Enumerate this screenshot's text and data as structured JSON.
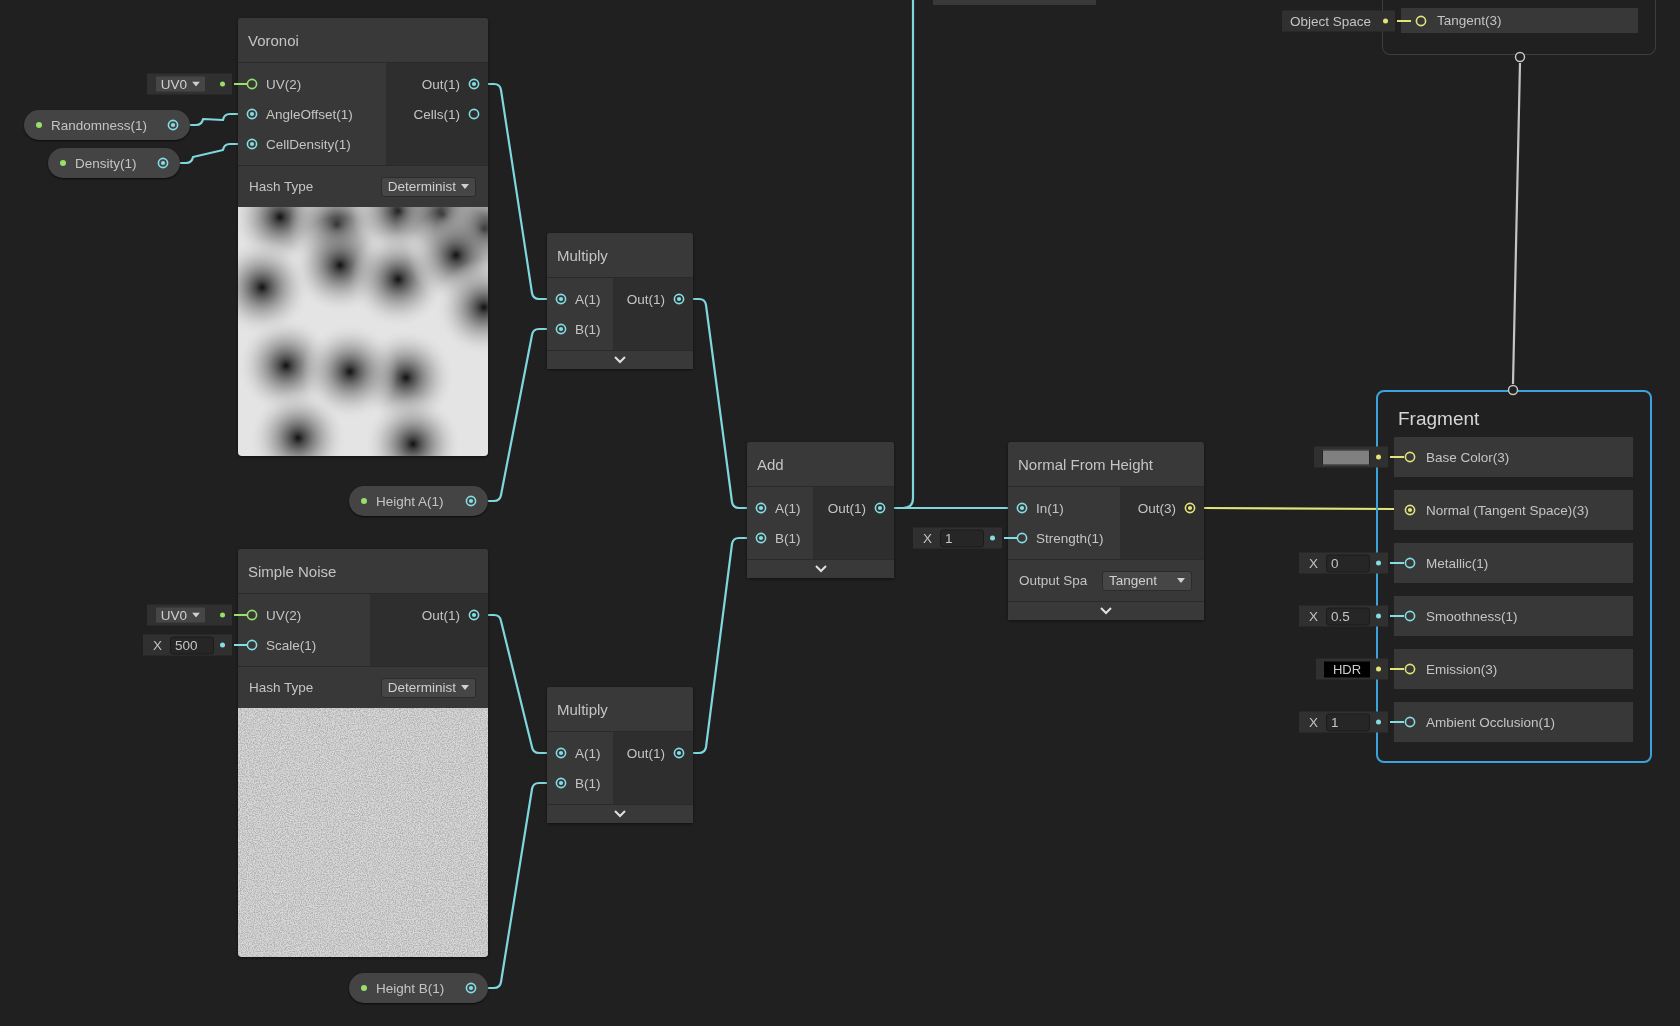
{
  "nodes": [
    {
      "title": "Voronoi",
      "inputs": [
        {
          "label": "UV(2)",
          "color": "#98e06a",
          "connected": false,
          "default": {
            "kind": "dropdown",
            "value": "UV0"
          }
        },
        {
          "label": "AngleOffset(1)",
          "color": "#84dde2",
          "connected": true
        },
        {
          "label": "CellDensity(1)",
          "color": "#84dde2",
          "connected": true
        }
      ],
      "outputs": [
        {
          "label": "Out(1)",
          "color": "#84dde2",
          "connected": true
        },
        {
          "label": "Cells(1)",
          "color": "#84dde2",
          "connected": false
        }
      ],
      "setting": {
        "label": "Hash Type",
        "value": "Determinist"
      },
      "preview": {
        "kind": "picture"
      },
      "expander": false
    },
    {
      "title": "Multiply",
      "inputs": [
        {
          "label": "A(1)",
          "color": "#84dde2",
          "connected": true
        },
        {
          "label": "B(1)",
          "color": "#84dde2",
          "connected": true
        }
      ],
      "outputs": [
        {
          "label": "Out(1)",
          "color": "#84dde2",
          "connected": true
        }
      ],
      "expander": true
    },
    {
      "title": "Add",
      "inputs": [
        {
          "label": "A(1)",
          "color": "#84dde2",
          "connected": true
        },
        {
          "label": "B(1)",
          "color": "#84dde2",
          "connected": true
        }
      ],
      "outputs": [
        {
          "label": "Out(1)",
          "color": "#84dde2",
          "connected": true
        }
      ],
      "expander": true
    },
    {
      "title": "Normal From Height",
      "inputs": [
        {
          "label": "In(1)",
          "color": "#84dde2",
          "connected": true
        },
        {
          "label": "Strength(1)",
          "color": "#84dde2",
          "connected": false,
          "default": {
            "kind": "number",
            "axis": "X",
            "value": "1"
          }
        }
      ],
      "outputs": [
        {
          "label": "Out(3)",
          "color": "#e3e37a",
          "connected": true
        }
      ],
      "setting": {
        "label": "Output Spa",
        "value": "Tangent"
      },
      "expander": true
    },
    {
      "title": "Simple Noise",
      "inputs": [
        {
          "label": "UV(2)",
          "color": "#98e06a",
          "connected": false,
          "default": {
            "kind": "dropdown",
            "value": "UV0"
          }
        },
        {
          "label": "Scale(1)",
          "color": "#84dde2",
          "connected": false,
          "default": {
            "kind": "number",
            "axis": "X",
            "value": "500"
          }
        }
      ],
      "outputs": [
        {
          "label": "Out(1)",
          "color": "#84dde2",
          "connected": true
        }
      ],
      "setting": {
        "label": "Hash Type",
        "value": "Determinist"
      },
      "preview": {
        "kind": "picture"
      },
      "expander": false
    },
    {
      "title": "Multiply",
      "inputs": [
        {
          "label": "A(1)",
          "color": "#84dde2",
          "connected": true
        },
        {
          "label": "B(1)",
          "color": "#84dde2",
          "connected": true
        }
      ],
      "outputs": [
        {
          "label": "Out(1)",
          "color": "#84dde2",
          "connected": true
        }
      ],
      "expander": true
    }
  ],
  "properties": [
    {
      "label": "Randomness(1)"
    },
    {
      "label": "Density(1)"
    },
    {
      "label": "Height A(1)"
    },
    {
      "label": "Height B(1)"
    }
  ],
  "vertex": {
    "slots": [
      {
        "label": "Tangent(3)",
        "color": "#e3e37a",
        "connected": false,
        "default": {
          "kind": "text",
          "value": "Object Space"
        }
      }
    ]
  },
  "fragment": {
    "title": "Fragment",
    "slots": [
      {
        "label": "Base Color(3)",
        "color": "#e3e37a",
        "connected": false,
        "default": {
          "kind": "swatch",
          "color": "#808080"
        }
      },
      {
        "label": "Normal (Tangent Space)(3)",
        "color": "#e3e37a",
        "connected": true
      },
      {
        "label": "Metallic(1)",
        "color": "#84dde2",
        "connected": false,
        "default": {
          "kind": "number",
          "axis": "X",
          "value": "0"
        }
      },
      {
        "label": "Smoothness(1)",
        "color": "#84dde2",
        "connected": false,
        "default": {
          "kind": "number",
          "axis": "X",
          "value": "0.5"
        }
      },
      {
        "label": "Emission(3)",
        "color": "#e3e37a",
        "connected": false,
        "default": {
          "kind": "hdr",
          "value": "HDR"
        }
      },
      {
        "label": "Ambient Occlusion(1)",
        "color": "#84dde2",
        "connected": false,
        "default": {
          "kind": "number",
          "axis": "X",
          "value": "1"
        }
      }
    ]
  }
}
